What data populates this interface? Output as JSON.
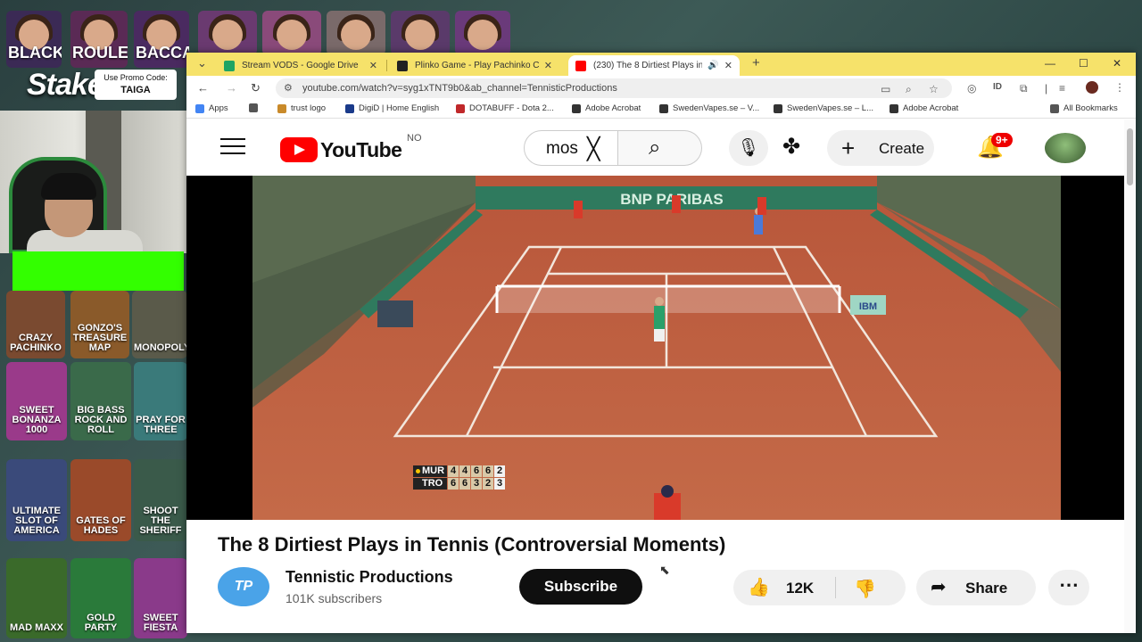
{
  "overlay": {
    "game_tiles": [
      {
        "label": "BLACKJACK",
        "color": "#3b2a55"
      },
      {
        "label": "ROULETTE",
        "color": "#5a2a55"
      },
      {
        "label": "BACCARAT",
        "color": "#4a2a60"
      },
      {
        "label": "",
        "color": "#6a3a70"
      },
      {
        "label": "",
        "color": "#8a4a7a"
      },
      {
        "label": "",
        "color": "#7a6a6a"
      },
      {
        "label": "",
        "color": "#5a3a6a"
      },
      {
        "label": "",
        "color": "#6a3a7a"
      },
      {
        "label": "CRAZY PACHINKO",
        "color": "#7a4a30"
      },
      {
        "label": "GONZO'S TREASURE MAP",
        "color": "#8a5a2a"
      },
      {
        "label": "MONOPOLY",
        "color": "#5a5a4a"
      },
      {
        "label": "SWEET BONANZA 1000",
        "color": "#9a3a8a"
      },
      {
        "label": "BIG BASS ROCK AND ROLL",
        "color": "#3a6a4a"
      },
      {
        "label": "PRAY FOR THREE",
        "color": "#3a7a7a"
      },
      {
        "label": "ULTIMATE SLOT OF AMERICA",
        "color": "#3a4a7a"
      },
      {
        "label": "GATES OF HADES",
        "color": "#9a4a2a"
      },
      {
        "label": "SHOOT THE SHERIFF",
        "color": "#3a5a4a"
      },
      {
        "label": "MAD MAXX",
        "color": "#3a6a2a"
      },
      {
        "label": "GOLD PARTY",
        "color": "#2a7a3a"
      },
      {
        "label": "SWEET FIESTA",
        "color": "#8a3a8a"
      }
    ],
    "brand": "Stake",
    "promo_label": "Use Promo Code:",
    "promo_code": "TAIGA",
    "greenscreen_color": "#33ff00"
  },
  "browser": {
    "tabs": [
      {
        "title": "Stream VODS - Google Drive",
        "favicon_color": "#1fa463",
        "active": false
      },
      {
        "title": "Plinko Game - Play Pachinko Ca",
        "favicon_color": "#222222",
        "active": false
      },
      {
        "title": "(230) The 8 Dirtiest Plays in",
        "favicon_color": "#ff0000",
        "active": true
      }
    ],
    "url": "youtube.com/watch?v=syg1xTNT9b0&ab_channel=TennisticProductions",
    "bookmarks": [
      {
        "label": "Apps",
        "icon_color": "#4285f4"
      },
      {
        "label": "",
        "icon_color": "#555555"
      },
      {
        "label": "trust logo",
        "icon_color": "#c98a2a"
      },
      {
        "label": "DigiD | Home English",
        "icon_color": "#1a3a8a"
      },
      {
        "label": "DOTABUFF - Dota 2...",
        "icon_color": "#c0282a"
      },
      {
        "label": "Adobe Acrobat",
        "icon_color": "#333333"
      },
      {
        "label": "SwedenVapes.se – V...",
        "icon_color": "#333333"
      },
      {
        "label": "SwedenVapes.se – L...",
        "icon_color": "#333333"
      },
      {
        "label": "Adobe Acrobat",
        "icon_color": "#333333"
      },
      {
        "label": "All Bookmarks",
        "icon_color": "#555555"
      }
    ]
  },
  "youtube": {
    "logo_text": "YouTube",
    "country": "NO",
    "search_value": "mos",
    "create_label": "Create",
    "notifications": "9+",
    "video": {
      "scoreboard": [
        {
          "player": "MUR",
          "scores": [
            "4",
            "4",
            "6",
            "6",
            "2"
          ],
          "serving": true
        },
        {
          "player": "TRO",
          "scores": [
            "6",
            "6",
            "3",
            "2",
            "3"
          ],
          "serving": false
        }
      ],
      "court_banner": "BNP PARIBAS",
      "sponsor_sign": "IBM"
    },
    "title": "The 8 Dirtiest Plays in Tennis (Controversial Moments)",
    "channel": {
      "name": "Tennistic Productions",
      "initials": "TP",
      "subscribers": "101K subscribers"
    },
    "subscribe_label": "Subscribe",
    "likes": "12K",
    "share_label": "Share",
    "accent": "#ff0000"
  }
}
